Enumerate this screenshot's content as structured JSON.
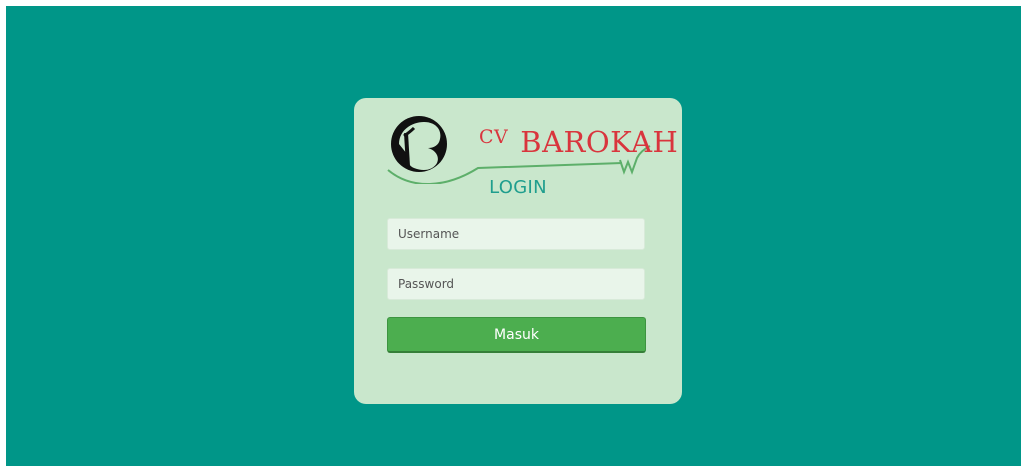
{
  "brand": {
    "prefix": "CV",
    "name": "BAROKAH",
    "text_color": "#d9353d",
    "swoosh_color": "#5daf6a"
  },
  "login": {
    "title": "LOGIN",
    "username_placeholder": "Username",
    "password_placeholder": "Password",
    "submit_label": "Masuk"
  },
  "colors": {
    "background": "#009688",
    "card": "#c9e7cc",
    "title": "#1f9e8e",
    "button": "#4cae4f"
  }
}
